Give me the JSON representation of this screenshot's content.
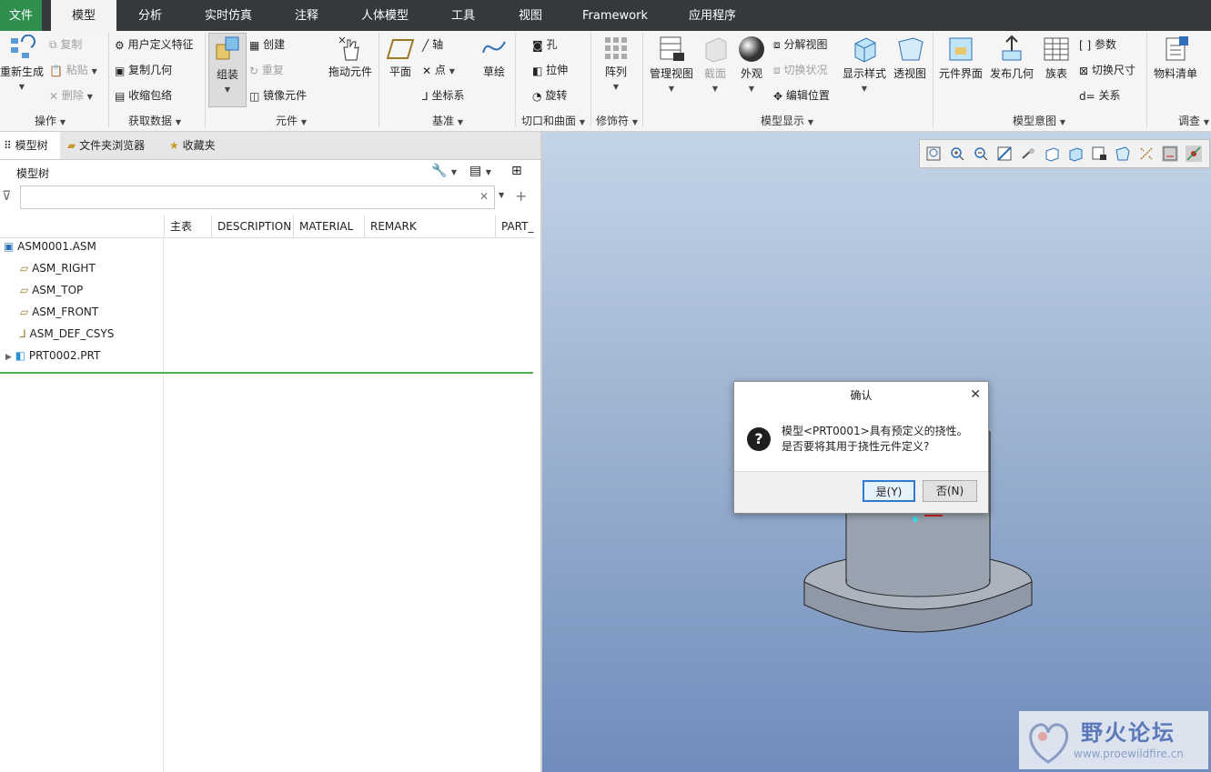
{
  "tabs": [
    "文件",
    "模型",
    "分析",
    "实时仿真",
    "注释",
    "人体模型",
    "工具",
    "视图",
    "Framework",
    "应用程序"
  ],
  "ribbon": {
    "ops": {
      "regen": "重新生成",
      "copy": "复制",
      "paste": "粘贴",
      "delete": "删除",
      "group": "操作"
    },
    "getdata": {
      "udf": "用户定义特征",
      "copygeom": "复制几何",
      "shrinkwrap": "收缩包络",
      "group": "获取数据"
    },
    "component": {
      "assemble": "组装",
      "create": "创建",
      "repeat": "重复",
      "mirror": "镜像元件",
      "drag": "拖动元件",
      "group": "元件"
    },
    "datum": {
      "plane": "平面",
      "axis": "轴",
      "point": "点",
      "csys": "坐标系",
      "sketch": "草绘",
      "group": "基准"
    },
    "cut": {
      "hole": "孔",
      "extrude": "拉伸",
      "revolve": "旋转",
      "group": "切口和曲面"
    },
    "modifier": {
      "pattern": "阵列",
      "group": "修饰符"
    },
    "display": {
      "manage": "管理视图",
      "section": "截面",
      "appearance": "外观",
      "explode": "分解视图",
      "toggle": "切换状况",
      "editpos": "编辑位置",
      "style": "显示样式",
      "perspective": "透视图",
      "group": "模型显示"
    },
    "intent": {
      "interface": "元件界面",
      "publish": "发布几何",
      "family": "族表",
      "params": "参数",
      "switchdim": "切换尺寸",
      "relations": "关系",
      "group": "模型意图"
    },
    "investigate": {
      "bom": "物料清单",
      "group": "调查"
    }
  },
  "left": {
    "tabs": [
      "模型树",
      "文件夹浏览器",
      "收藏夹"
    ],
    "title": "模型树",
    "columns": [
      "主表",
      "DESCRIPTION",
      "MATERIAL",
      "REMARK",
      "PART_"
    ],
    "tree": [
      "ASM0001.ASM",
      "ASM_RIGHT",
      "ASM_TOP",
      "ASM_FRONT",
      "ASM_DEF_CSYS",
      "PRT0002.PRT"
    ]
  },
  "dialog": {
    "title": "确认",
    "line1": "模型<PRT0001>具有预定义的挠性。",
    "line2": "是否要将其用于挠性元件定义?",
    "yes": "是(Y)",
    "no": "否(N)"
  },
  "watermark": {
    "name": "野火论坛",
    "url": "www.proewildfire.cn"
  },
  "colors": {
    "file_tab": "#2f8f4e",
    "tabbar": "#36393c",
    "accent_green": "#4caf50"
  }
}
